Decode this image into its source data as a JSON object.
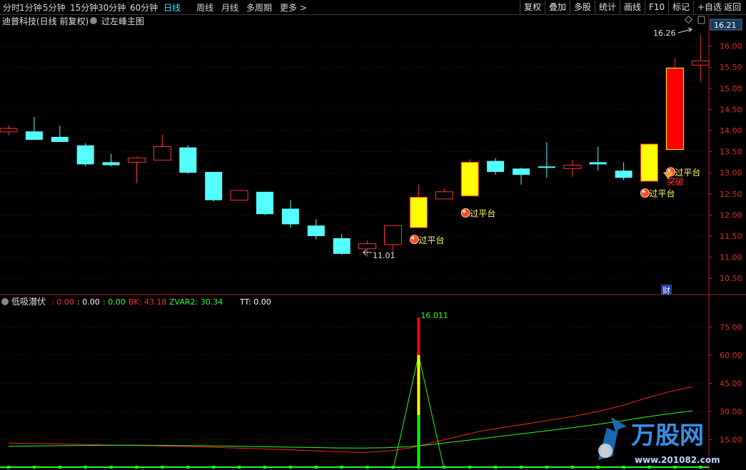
{
  "toolbar": {
    "left": [
      "分时",
      "1分钟",
      "5分钟",
      "15分钟",
      "30分钟",
      "60分钟",
      "日线",
      "周线",
      "月线",
      "多周期",
      "更多 >"
    ],
    "active_index": 6,
    "right": [
      "复权",
      "叠加",
      "多股",
      "统计",
      "画线",
      "F10",
      "标记",
      "+自选",
      "返回"
    ]
  },
  "main_title": {
    "stock": "迪普科技(日线 前复权)",
    "indicator": "过左峰主图"
  },
  "price_axis": {
    "ticks": [
      "16.00",
      "15.50",
      "15.00",
      "14.50",
      "14.00",
      "13.50",
      "13.00",
      "12.50",
      "12.00",
      "11.50",
      "11.00",
      "10.50"
    ],
    "current_price": "16.21"
  },
  "annotations": {
    "high_label": "16.26",
    "low_label": "11.01",
    "signal": "过平台",
    "breakout": "突破",
    "finance_badge": "财"
  },
  "sub_indicator": {
    "name": "低吸潜伏",
    "values": [
      {
        "text": ": 0.00",
        "color": "#ff3030"
      },
      {
        "text": ": 0.00",
        "color": "#ffffff"
      },
      {
        "text": ": 0.00",
        "color": "#33ff33"
      },
      {
        "text": "BK: 43.18",
        "color": "#ff3030"
      },
      {
        "text": "ZVAR2: 30.34",
        "color": "#33ff33"
      },
      {
        "text": "TT: 0.00",
        "color": "#ffffff"
      }
    ],
    "peak_label": "16.011",
    "axis_ticks": [
      "75.00",
      "60.00",
      "45.00",
      "30.00",
      "15.00"
    ]
  },
  "watermark": {
    "brand": "万股网",
    "url": "www.201082.com"
  },
  "chart_data": {
    "type": "candlestick",
    "price_ylim": [
      10.2,
      16.45
    ],
    "candles": [
      {
        "o": 14.05,
        "h": 14.12,
        "l": 13.88,
        "c": 13.97,
        "color": "red"
      },
      {
        "o": 13.98,
        "h": 14.32,
        "l": 13.78,
        "c": 13.78,
        "color": "cyan"
      },
      {
        "o": 13.85,
        "h": 14.12,
        "l": 13.73,
        "c": 13.73,
        "color": "cyan"
      },
      {
        "o": 13.65,
        "h": 13.7,
        "l": 13.15,
        "c": 13.2,
        "color": "cyan"
      },
      {
        "o": 13.25,
        "h": 13.45,
        "l": 13.15,
        "c": 13.18,
        "color": "cyan"
      },
      {
        "o": 13.25,
        "h": 13.38,
        "l": 12.75,
        "c": 13.35,
        "color": "red"
      },
      {
        "o": 13.3,
        "h": 13.9,
        "l": 13.3,
        "c": 13.62,
        "color": "red"
      },
      {
        "o": 13.6,
        "h": 13.65,
        "l": 12.98,
        "c": 13.0,
        "color": "cyan"
      },
      {
        "o": 13.02,
        "h": 13.02,
        "l": 12.32,
        "c": 12.35,
        "color": "cyan"
      },
      {
        "o": 12.35,
        "h": 12.58,
        "l": 12.35,
        "c": 12.58,
        "color": "red"
      },
      {
        "o": 12.55,
        "h": 12.55,
        "l": 12.0,
        "c": 12.02,
        "color": "cyan"
      },
      {
        "o": 12.15,
        "h": 12.35,
        "l": 11.7,
        "c": 11.78,
        "color": "cyan"
      },
      {
        "o": 11.75,
        "h": 11.9,
        "l": 11.42,
        "c": 11.5,
        "color": "cyan"
      },
      {
        "o": 11.45,
        "h": 11.55,
        "l": 11.06,
        "c": 11.08,
        "color": "cyan"
      },
      {
        "o": 11.2,
        "h": 11.4,
        "l": 11.01,
        "c": 11.32,
        "color": "red"
      },
      {
        "o": 11.3,
        "h": 11.45,
        "l": 11.1,
        "c": 11.75,
        "color": "red"
      },
      {
        "o": 11.7,
        "h": 12.72,
        "l": 11.72,
        "c": 12.42,
        "color": "yellow"
      },
      {
        "o": 12.38,
        "h": 12.62,
        "l": 12.38,
        "c": 12.55,
        "color": "red"
      },
      {
        "o": 12.45,
        "h": 13.32,
        "l": 12.45,
        "c": 13.25,
        "color": "yellow"
      },
      {
        "o": 13.28,
        "h": 13.35,
        "l": 12.95,
        "c": 13.02,
        "color": "cyan"
      },
      {
        "o": 13.1,
        "h": 13.12,
        "l": 12.72,
        "c": 12.95,
        "color": "cyan"
      },
      {
        "o": 13.12,
        "h": 13.72,
        "l": 12.88,
        "c": 13.15,
        "color": "cyan"
      },
      {
        "o": 13.1,
        "h": 13.3,
        "l": 12.9,
        "c": 13.18,
        "color": "red"
      },
      {
        "o": 13.25,
        "h": 13.62,
        "l": 13.05,
        "c": 13.2,
        "color": "cyan"
      },
      {
        "o": 13.05,
        "h": 13.25,
        "l": 12.82,
        "c": 12.88,
        "color": "cyan"
      },
      {
        "o": 12.8,
        "h": 13.68,
        "l": 12.8,
        "c": 13.68,
        "color": "yellow"
      },
      {
        "o": 13.55,
        "h": 15.72,
        "l": 13.55,
        "c": 15.48,
        "color": "redfill"
      },
      {
        "o": 15.55,
        "h": 16.26,
        "l": 15.15,
        "c": 15.65,
        "color": "red"
      }
    ],
    "signals": [
      {
        "index": 16,
        "price": 11.42,
        "label": "过平台"
      },
      {
        "index": 18,
        "price": 12.05,
        "label": "过平台"
      },
      {
        "index": 25,
        "price": 12.52,
        "label": "过平台"
      },
      {
        "index": 26,
        "price": 13.02,
        "label": "过平台"
      }
    ],
    "sub_ylim": [
      0,
      85
    ],
    "bk": [
      13.2,
      13.0,
      12.8,
      12.5,
      12.2,
      12.0,
      11.8,
      11.5,
      11.2,
      10.8,
      10.4,
      10.0,
      9.6,
      9.0,
      8.6,
      8.2,
      8.8,
      10.5,
      13.5,
      16.5,
      19.5,
      21.5,
      23.5,
      25.5,
      27.5,
      30.0,
      33.0,
      37.0,
      40.5,
      43.18
    ],
    "zvar2": [
      11.5,
      11.6,
      11.8,
      11.9,
      12.0,
      12.1,
      12.0,
      11.9,
      11.8,
      11.6,
      11.4,
      11.2,
      11.0,
      10.8,
      10.6,
      10.5,
      10.7,
      11.3,
      12.5,
      14.0,
      15.5,
      17.0,
      18.5,
      20.0,
      21.5,
      23.2,
      25.0,
      27.0,
      28.8,
      30.34
    ],
    "spike": {
      "index": 16,
      "value": 60.0,
      "top": 80.0
    }
  }
}
